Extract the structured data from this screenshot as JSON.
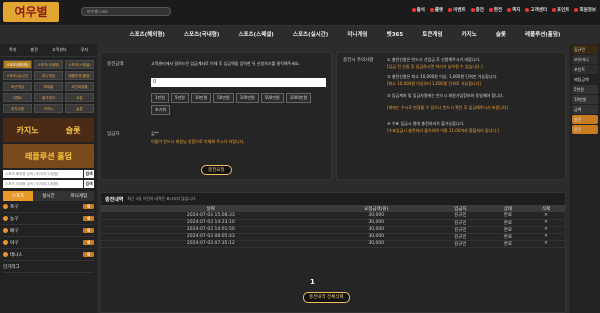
{
  "header": {
    "logo": "여우별",
    "search_value": "여우별.com",
    "menu": [
      "출석",
      "룰렛",
      "이벤트",
      "충전",
      "환전",
      "쪽지",
      "고객센터",
      "포인트",
      "회원정보"
    ]
  },
  "nav": [
    "스포츠(해외형)",
    "스포츠(국내형)",
    "스포츠(스페셜)",
    "스포츠(실시간)",
    "미니게임",
    "벳365",
    "토큰게임",
    "카지노",
    "슬롯",
    "레플루션(홀덤)"
  ],
  "left": {
    "top_buttons": [
      "쪽지",
      "충전",
      "고객센터",
      "루저"
    ],
    "grid": [
      "스포츠(해외형)",
      "스포츠(국내형)",
      "스포츠(스페셜)",
      "스포츠(실시간)",
      "미니게임",
      "레플루션(홀덤)",
      "토큰게임",
      "파워볼",
      "코인파워볼",
      "이벤트",
      "출석체크",
      "쿠폰",
      "공지사항",
      "카지노",
      "슬롯"
    ],
    "banner1": [
      "카지노",
      "슬롯"
    ],
    "banner2": "레플루션 홀덤",
    "search1": "스포츠 해외형 검색 (국가/리그/팀명)",
    "search2": "스포츠 국내형 검색 (국가/리그/팀명)",
    "search_btn": "검색",
    "tabs": [
      "스포츠",
      "실시간",
      "미니게임"
    ],
    "sports": [
      {
        "name": "축구",
        "count": "0"
      },
      {
        "name": "농구",
        "count": "0"
      },
      {
        "name": "배구",
        "count": "0"
      },
      {
        "name": "야구",
        "count": "0"
      },
      {
        "name": "테니스",
        "count": "0"
      }
    ],
    "more": "인기리그"
  },
  "form": {
    "label_amount": "충전금액",
    "desc": "고객센터에서 알려드린 입금계좌로 이체 후 입금액을 입력한 뒤 신청하기를 클릭해주세요.",
    "input_value": "0",
    "amounts": [
      "1만원",
      "5만원",
      "10만원",
      "50만원",
      "100만원",
      "500만원",
      "1000만원",
      "초기화"
    ],
    "label_name": "입금자",
    "name_value": "김**",
    "name_note": "이름이 반드시 회원님 성함으로 이체해 주시기 바랍니다.",
    "submit": "충전요청"
  },
  "notes": {
    "label": "충전시 주의사항",
    "items": [
      "① 충전신청은 반드시 선입금 후 신청해주시기 바랍니다.",
      "[입금 전 신청 후 입금하시면 처리가 늦어질 수 있습니다.]",
      "② 충전신청은 최소 10,000원 이상, 1,000원 단위만 가능합니다.",
      "[최소 10,000원 이상부터 1,000원 단위로 가능합니다]",
      "③ 입금계좌 및 입금자명에는 반드시 회원가입정보와 동일해야 합니다.",
      "[계좌는 수시로 변경될 수 있으니 반드시 확인 후 입금해주시기 바랍니다]",
      "④ 수표 입금시 절대 충전처리가 불가능합니다.",
      "[수표입금시 충전처리 불가하며 이용 11:00까지 환불처리 됩니다.]"
    ]
  },
  "history": {
    "title": "충전내역",
    "subtitle": "최근 3일 이전의 내역은 표시되지 않습니다.",
    "columns": [
      "날짜",
      "요청금액(원)",
      "입금자",
      "상태",
      "삭제"
    ],
    "rows": [
      {
        "date": "2024-07-03 15:08:33",
        "amount": "30,000",
        "name": "김규민",
        "status": "완료"
      },
      {
        "date": "2024-07-03 14:23:10",
        "amount": "30,000",
        "name": "김규민",
        "status": "완료"
      },
      {
        "date": "2024-07-03 14:01:50",
        "amount": "30,000",
        "name": "김규민",
        "status": "완료"
      },
      {
        "date": "2024-07-03 08:05:43",
        "amount": "30,000",
        "name": "김규민",
        "status": "완료"
      },
      {
        "date": "2024-07-03 07:35:12",
        "amount": "30,000",
        "name": "김규민",
        "status": "완료"
      }
    ],
    "page": "1",
    "delete_all": "충전내역 전체삭제"
  },
  "right": [
    "김규민",
    "보유머니",
    "포인트",
    "배팅금액",
    "5천원",
    "10만원",
    "금액",
    "충전",
    "환전"
  ]
}
